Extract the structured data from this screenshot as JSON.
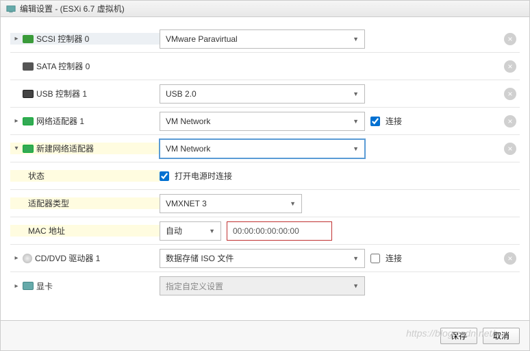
{
  "title": "编辑设置 -                    (ESXi 6.7 虚拟机)",
  "rows": {
    "scsi": {
      "label": "SCSI 控制器 0",
      "value": "VMware Paravirtual"
    },
    "sata": {
      "label": "SATA 控制器 0"
    },
    "usb": {
      "label": "USB 控制器 1",
      "value": "USB 2.0"
    },
    "nic1": {
      "label": "网络适配器 1",
      "value": "VM Network",
      "connect": "连接"
    },
    "nic_new": {
      "label": "新建网络适配器",
      "value": "VM Network"
    },
    "status": {
      "label": "状态",
      "value": "打开电源时连接"
    },
    "adapter_type": {
      "label": "适配器类型",
      "value": "VMXNET 3"
    },
    "mac": {
      "label": "MAC 地址",
      "mode": "自动",
      "value": "00:00:00:00:00:00"
    },
    "cd": {
      "label": "CD/DVD 驱动器 1",
      "value": "数据存储 ISO 文件",
      "connect": "连接"
    },
    "gpu": {
      "label": "显卡",
      "value": "指定自定义设置"
    }
  },
  "footer": {
    "save": "保存",
    "cancel": "取消"
  },
  "watermark": "https://blog.csdn.net/..."
}
